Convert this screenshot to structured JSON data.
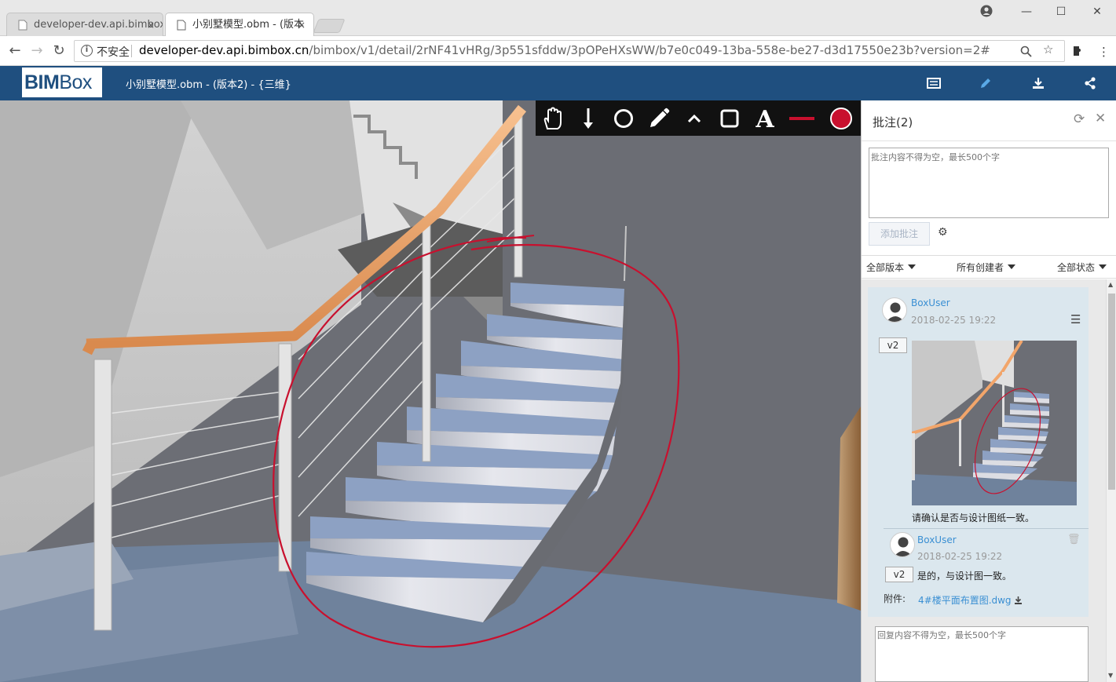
{
  "browser": {
    "tabs": [
      {
        "title": "developer-dev.api.bimbox",
        "close": "×"
      },
      {
        "title": "小别墅模型.obm - (版本",
        "close": "×"
      }
    ],
    "window_controls": {
      "minimize": "—",
      "maximize": "☐",
      "close": "✕"
    },
    "address": {
      "security_label": "不安全",
      "host": "developer-dev.api.bimbox.cn",
      "path": "/bimbox/v1/detail/2rNF41vHRg/3p551sfddw/3pOPeHXsWW/b7e0c049-13ba-558e-be27-d3d17550e23b?version=2#"
    }
  },
  "app": {
    "logo_bold": "BIM",
    "logo_rest": "Box",
    "title": "小别墅模型.obm - (版本2) - {三维}"
  },
  "toolbar": {
    "tools": [
      "hand-icon",
      "arrow-icon",
      "circle-icon",
      "pencil-icon",
      "chevron-up-icon",
      "rectangle-icon",
      "text-icon",
      "line-color-icon",
      "fill-color-icon"
    ],
    "stroke_color": "#c8102e",
    "fill_color": "#c8102e",
    "text_glyph": "A"
  },
  "panel": {
    "title": "批注(2)",
    "comment_placeholder": "批注内容不得为空，最长500个字",
    "add_button": "添加批注",
    "filters": [
      "全部版本",
      "所有创建者",
      "全部状态"
    ],
    "comments": [
      {
        "user": "BoxUser",
        "time": "2018-02-25 19:22",
        "version": "v2",
        "text": "请确认是否与设计图纸一致。",
        "replies": [
          {
            "user": "BoxUser",
            "time": "2018-02-25 19:22",
            "version": "v2",
            "text": "是的，与设计图一致。",
            "attachment_label": "附件:",
            "attachment_name": "4#楼平面布置图.dwg"
          }
        ]
      }
    ],
    "reply_placeholder": "回复内容不得为空，最长500个字"
  },
  "colors": {
    "header": "#1f4f7f",
    "link": "#3a8fd3",
    "annotation": "#c8102e",
    "card_bg": "#dbe7ee"
  }
}
